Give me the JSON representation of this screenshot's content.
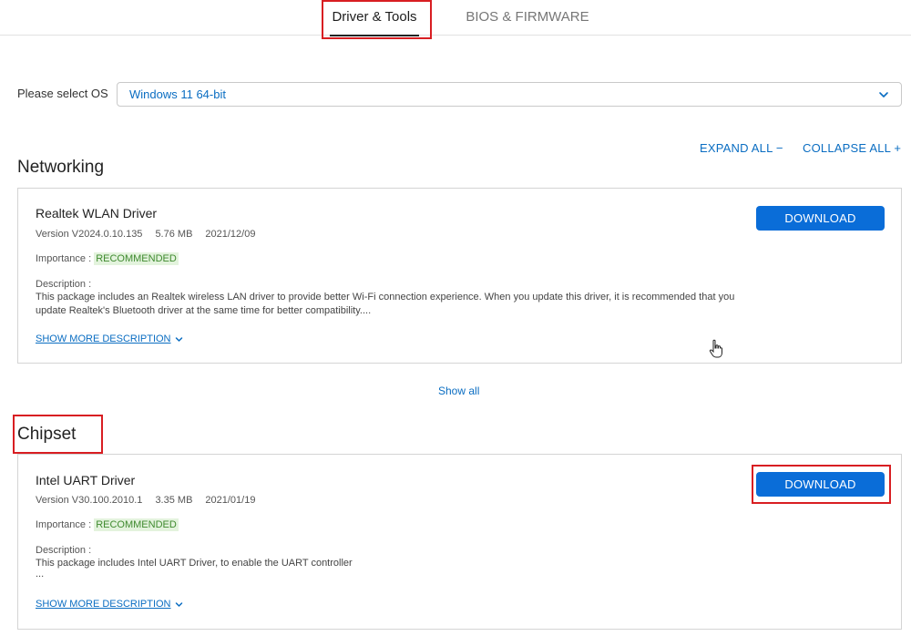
{
  "tabs": {
    "drivers": "Driver & Tools",
    "bios": "BIOS & FIRMWARE"
  },
  "os": {
    "label": "Please select OS",
    "selected": "Windows 11 64-bit"
  },
  "actions": {
    "expand_all": "EXPAND ALL −",
    "collapse_all": "COLLAPSE ALL +"
  },
  "sections": [
    {
      "title": "Networking",
      "driver": {
        "name": "Realtek WLAN Driver",
        "version": "Version V2024.0.10.135",
        "size": "5.76 MB",
        "date": "2021/12/09",
        "importance_label": "Importance :",
        "importance": "RECOMMENDED",
        "description_label": "Description :",
        "description": "This package includes an Realtek wireless LAN driver to provide better Wi-Fi connection experience. When you update this driver, it is recommended that you update Realtek's Bluetooth driver at the same time for better compatibility....",
        "show_more": "SHOW MORE DESCRIPTION",
        "download": "DOWNLOAD"
      },
      "show_all": "Show all"
    },
    {
      "title": "Chipset",
      "driver": {
        "name": "Intel UART Driver",
        "version": "Version V30.100.2010.1",
        "size": "3.35 MB",
        "date": "2021/01/19",
        "importance_label": "Importance :",
        "importance": "RECOMMENDED",
        "description_label": "Description :",
        "description": "This package includes Intel UART Driver, to enable the UART controller",
        "description_more": "...",
        "show_more": "SHOW MORE DESCRIPTION",
        "download": "DOWNLOAD"
      }
    }
  ],
  "colors": {
    "accent": "#0a6dc2",
    "button": "#0a6dd8",
    "highlight": "#d81e22",
    "recommended": "#3f8a2f"
  }
}
